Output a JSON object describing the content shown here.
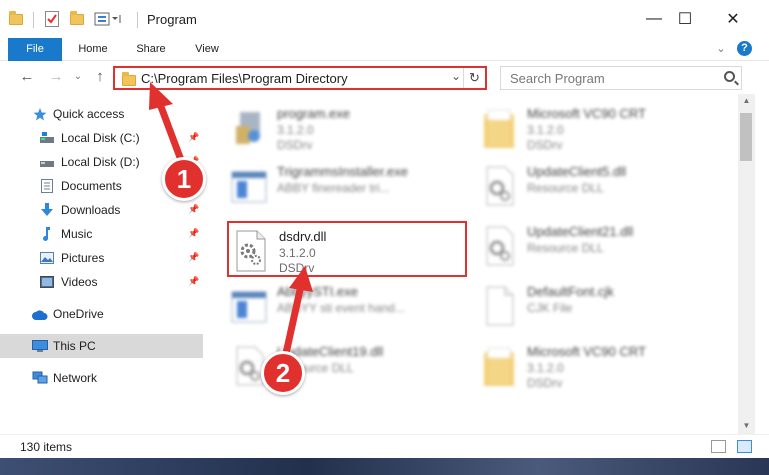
{
  "window": {
    "title": "Program",
    "controls": {
      "minimize": "—",
      "maximize": "☐",
      "close": "✕"
    }
  },
  "ribbon": {
    "tabs": [
      "File",
      "Home",
      "Share",
      "View"
    ],
    "help": "?",
    "expand": "⌄"
  },
  "address": {
    "path": "C:\\Program Files\\Program Directory",
    "dropdown": "⌄",
    "refresh": "↻"
  },
  "search": {
    "placeholder": "Search Program"
  },
  "sidebar": {
    "items": [
      {
        "label": "Quick access",
        "pinned": false
      },
      {
        "label": "Local Disk (C:)",
        "pinned": true
      },
      {
        "label": "Local Disk (D:)",
        "pinned": true
      },
      {
        "label": "Documents",
        "pinned": true
      },
      {
        "label": "Downloads",
        "pinned": true
      },
      {
        "label": "Music",
        "pinned": true
      },
      {
        "label": "Pictures",
        "pinned": true
      },
      {
        "label": "Videos",
        "pinned": true
      },
      {
        "label": "OneDrive",
        "pinned": false
      },
      {
        "label": "This PC",
        "pinned": false
      },
      {
        "label": "Network",
        "pinned": false
      }
    ]
  },
  "files": [
    {
      "name": "program.exe",
      "line2": "3.1.2.0",
      "line3": "DSDrv",
      "icon": "exe-icon"
    },
    {
      "name": "Microsoft VC90 CRT",
      "line2": "3.1.2.0",
      "line3": "DSDrv",
      "icon": "folder-icon"
    },
    {
      "name": "TrigrammsInstaller.exe",
      "line2": "ABBY finereader tri...",
      "line3": "",
      "icon": "app-window-icon"
    },
    {
      "name": "UpdateClient5.dll",
      "line2": "Resource DLL",
      "line3": "",
      "icon": "dll-icon"
    },
    {
      "name": "dsdrv.dll",
      "line2": "3.1.2.0",
      "line3": "DSDrv",
      "icon": "dll-icon"
    },
    {
      "name": "UpdateClient21.dll",
      "line2": "Resource DLL",
      "line3": "",
      "icon": "dll-icon"
    },
    {
      "name": "AbbyySTI.exe",
      "line2": "ABBYY sti event hand...",
      "line3": "",
      "icon": "app-window-icon"
    },
    {
      "name": "DefaultFont.cjk",
      "line2": "CJK File",
      "line3": "",
      "icon": "blank-file-icon"
    },
    {
      "name": "UpdateClient19.dll",
      "line2": "Resource DLL",
      "line3": "",
      "icon": "dll-icon"
    },
    {
      "name": "Microsoft VC90 CRT",
      "line2": "3.1.2.0",
      "line3": "DSDrv",
      "icon": "folder-icon"
    }
  ],
  "status": {
    "count": "130 items"
  },
  "callouts": [
    "1",
    "2"
  ],
  "colors": {
    "accent": "#1979ca",
    "highlight": "#e0312e",
    "selected": "#d9d9d9"
  }
}
